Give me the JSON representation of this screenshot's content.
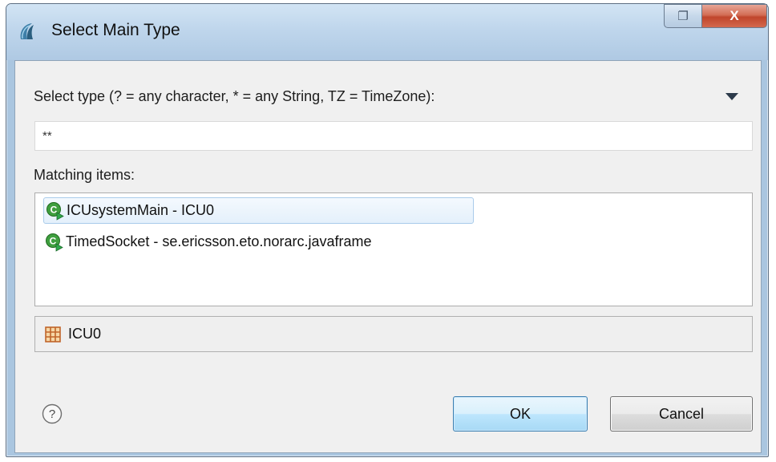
{
  "window": {
    "title": "Select Main Type",
    "close_glyph": "X",
    "restore_glyph": "❐"
  },
  "prompt": {
    "label": "Select type (? = any character, * = any String, TZ = TimeZone):"
  },
  "search": {
    "value": "**"
  },
  "matching": {
    "label": "Matching items:",
    "items": [
      {
        "label": "ICUsystemMain - ICU0",
        "selected": true,
        "icon": "main-class-icon"
      },
      {
        "label": "TimedSocket - se.ericsson.eto.norarc.javaframe",
        "selected": false,
        "icon": "main-class-icon"
      }
    ]
  },
  "status": {
    "package": "ICU0",
    "icon": "package-icon"
  },
  "buttons": {
    "ok": "OK",
    "cancel": "Cancel"
  },
  "colors": {
    "selection_border": "#a9cbea",
    "ok_border": "#3c7fb1",
    "icon_green": "#3f9f3f",
    "package_orange": "#c0652a"
  }
}
